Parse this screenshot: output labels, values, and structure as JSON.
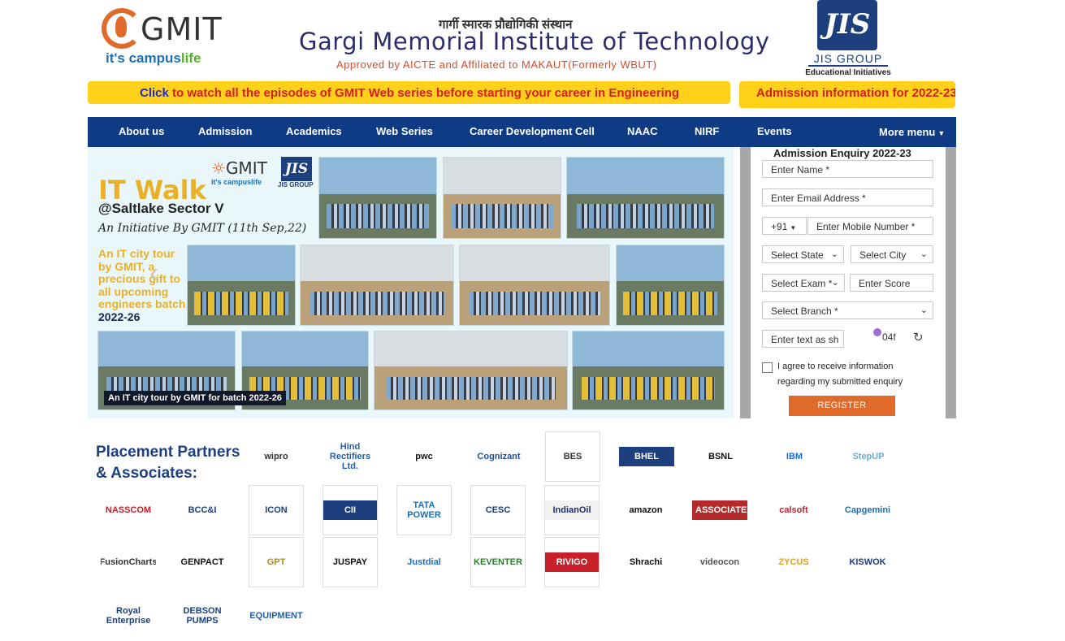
{
  "header": {
    "gmit_word": "GMIT",
    "gmit_tag_a": "it's campus",
    "gmit_tag_b": "life",
    "title_hindi": "गार्गी स्मारक प्रौद्योगिकी संस्थान",
    "title_main": "Gargi Memorial Institute of Technology",
    "title_sub": "Approved by AICTE and Affiliated to MAKAUT(Formerly WBUT)",
    "jis_mark": "JIS",
    "jis_name": "JIS GROUP",
    "jis_sub": "Educational Initiatives"
  },
  "ticker": {
    "click": "Click",
    "text": " to watch all the episodes of GMIT Web series before starting your career in Engineering",
    "admission": "Admission information for 2022-23"
  },
  "nav": {
    "items": [
      "About us",
      "Admission",
      "Academics",
      "Web Series",
      "Career Development Cell",
      "NAAC",
      "NIRF",
      "Events",
      "More menu"
    ]
  },
  "banner": {
    "mini_gmit": "GMIT",
    "mini_tag": "it's campuslife",
    "mini_jis": "JIS",
    "mini_jis_text": "JIS GROUP",
    "title": "IT Walk",
    "location": "@Saltlake Sector V",
    "initiative": "An Initiative By GMIT (11th Sep,22)",
    "text": "An IT city tour by GMIT, a precious gift to all upcoming engineers batch",
    "batch": "2022-26",
    "caption": "An IT city tour by GMIT for batch 2022-26",
    "arrow": "‹"
  },
  "form": {
    "title": "Admission Enquiry 2022-23",
    "name_placeholder": "Enter Name *",
    "email_placeholder": "Enter Email Address *",
    "country_code": "+91",
    "mobile_placeholder": "Enter Mobile Number *",
    "state": "Select State",
    "city": "Select City",
    "exam": "Select Exam *",
    "score_placeholder": "Enter Score",
    "branch": "Select Branch *",
    "captcha_placeholder": "Enter text as sh",
    "captcha_text": "04f",
    "agree": "I agree to receive information regarding my submitted enquiry",
    "register": "REGISTER"
  },
  "partners": {
    "title": "Placement Partners & Associates:",
    "logos": [
      {
        "label": "wipro",
        "color": "#333"
      },
      {
        "label": "Hind Rectifiers Ltd.",
        "color": "#1e5fb0"
      },
      {
        "label": "pwc",
        "color": "#111"
      },
      {
        "label": "Cognizant",
        "color": "#1e4fa0"
      },
      {
        "label": "BES",
        "color": "#333"
      },
      {
        "label": "BHEL",
        "color": "#ffffff"
      },
      {
        "label": "BSNL",
        "color": "#111"
      },
      {
        "label": "IBM",
        "color": "#1f6fd0"
      },
      {
        "label": "StepUP",
        "color": "#6aa8d8"
      },
      {
        "label": "NASSCOM",
        "color": "#c8202a"
      },
      {
        "label": "BCC&I",
        "color": "#1d3f7d"
      },
      {
        "label": "ICON",
        "color": "#1d3f7d"
      },
      {
        "label": "CII",
        "color": "#ffffff"
      },
      {
        "label": "TATA POWER",
        "color": "#1e6fb4"
      },
      {
        "label": "CESC",
        "color": "#1d3f7d"
      },
      {
        "label": "IndianOil",
        "color": "#1d2f6a"
      },
      {
        "label": "amazon",
        "color": "#111"
      },
      {
        "label": "ASSOCIATED",
        "color": "#ffffff"
      },
      {
        "label": "calsoft",
        "color": "#c8202a"
      },
      {
        "label": "Capgemini",
        "color": "#1e6fb4"
      },
      {
        "label": "FusionCharts",
        "color": "#333"
      },
      {
        "label": "GENPACT",
        "color": "#111"
      },
      {
        "label": "GPT",
        "color": "#b08a2a"
      },
      {
        "label": "JUSPAY",
        "color": "#111"
      },
      {
        "label": "Justdial",
        "color": "#1e6fd0"
      },
      {
        "label": "KEVENTER",
        "color": "#2c7d2c"
      },
      {
        "label": "RIVIGO",
        "color": "#ffffff"
      },
      {
        "label": "Shrachi",
        "color": "#111"
      },
      {
        "label": "videocon",
        "color": "#555"
      },
      {
        "label": "ZYCUS",
        "color": "#e0a020"
      },
      {
        "label": "KISWOK",
        "color": "#1d3f7d"
      },
      {
        "label": "Royal Enterprise",
        "color": "#1d3f7d"
      },
      {
        "label": "DEBSON PUMPS",
        "color": "#1d3f7d"
      },
      {
        "label": "EQUIPMENT",
        "color": "#1e5fb0"
      }
    ]
  },
  "colors": {
    "nav_bg": "#0f3a84",
    "ticker_bg": "#ffd11a",
    "accent_orange": "#e06a2a",
    "title_blue": "#2c2c6c"
  }
}
